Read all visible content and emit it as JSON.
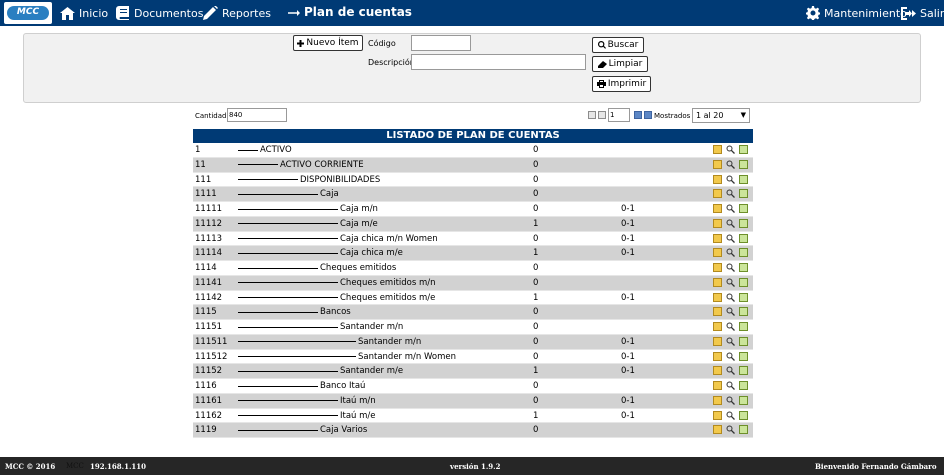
{
  "navbar": {
    "logo_text": "MCC",
    "items": [
      {
        "label": "Inicio",
        "icon": "home-icon"
      },
      {
        "label": "Documentos",
        "icon": "book-icon"
      },
      {
        "label": "Reportes",
        "icon": "pencil-icon"
      }
    ],
    "page_title": "Plan de cuentas",
    "right_items": [
      {
        "label": "Mantenimiento",
        "icon": "gear-icon"
      },
      {
        "label": "Salir",
        "icon": "sign-out-icon"
      }
    ]
  },
  "filter": {
    "new_item_label": "Nuevo Ítem",
    "codigo_label": "Código",
    "codigo_value": "",
    "descripcion_label": "Descripción",
    "descripcion_value": "",
    "buscar_label": "Buscar",
    "limpiar_label": "Limpiar",
    "imprimir_label": "Imprimir"
  },
  "listing": {
    "cantidad_label": "Cantidad",
    "cantidad_value": "840",
    "page_value": "1",
    "mostrados_label": "Mostrados",
    "mostrados_value": "1 al 20"
  },
  "table": {
    "title": "LISTADO DE PLAN DE CUENTAS",
    "rows": [
      {
        "code": "1",
        "level": 1,
        "desc": "ACTIVO",
        "val": "0",
        "ref": ""
      },
      {
        "code": "11",
        "level": 2,
        "desc": "ACTIVO CORRIENTE",
        "val": "0",
        "ref": ""
      },
      {
        "code": "111",
        "level": 3,
        "desc": "DISPONIBILIDADES",
        "val": "0",
        "ref": ""
      },
      {
        "code": "1111",
        "level": 4,
        "desc": "Caja",
        "val": "0",
        "ref": ""
      },
      {
        "code": "11111",
        "level": 5,
        "desc": "Caja m/n",
        "val": "0",
        "ref": "0-1"
      },
      {
        "code": "11112",
        "level": 5,
        "desc": "Caja m/e",
        "val": "1",
        "ref": "0-1"
      },
      {
        "code": "11113",
        "level": 5,
        "desc": "Caja chica m/n Women",
        "val": "0",
        "ref": "0-1"
      },
      {
        "code": "11114",
        "level": 5,
        "desc": "Caja chica m/e",
        "val": "1",
        "ref": "0-1"
      },
      {
        "code": "1114",
        "level": 4,
        "desc": "Cheques emitidos",
        "val": "0",
        "ref": ""
      },
      {
        "code": "11141",
        "level": 5,
        "desc": "Cheques emitidos m/n",
        "val": "0",
        "ref": ""
      },
      {
        "code": "11142",
        "level": 5,
        "desc": "Cheques emitidos m/e",
        "val": "1",
        "ref": "0-1"
      },
      {
        "code": "1115",
        "level": 4,
        "desc": "Bancos",
        "val": "0",
        "ref": ""
      },
      {
        "code": "11151",
        "level": 5,
        "desc": "Santander m/n",
        "val": "0",
        "ref": ""
      },
      {
        "code": "111511",
        "level": 6,
        "desc": "Santander m/n",
        "val": "0",
        "ref": "0-1"
      },
      {
        "code": "111512",
        "level": 6,
        "desc": "Santander m/n Women",
        "val": "0",
        "ref": "0-1"
      },
      {
        "code": "11152",
        "level": 5,
        "desc": "Santander m/e",
        "val": "1",
        "ref": "0-1"
      },
      {
        "code": "1116",
        "level": 4,
        "desc": "Banco Itaú",
        "val": "0",
        "ref": ""
      },
      {
        "code": "11161",
        "level": 5,
        "desc": "Itaú m/n",
        "val": "0",
        "ref": "0-1"
      },
      {
        "code": "11162",
        "level": 5,
        "desc": "Itaú m/e",
        "val": "1",
        "ref": "0-1"
      },
      {
        "code": "1119",
        "level": 4,
        "desc": "Caja Varios",
        "val": "0",
        "ref": ""
      }
    ]
  },
  "footer": {
    "copyright": "MCC © 2016",
    "brand": "MCC",
    "ip": "192.168.1.110",
    "version": "versión 1.9.2",
    "welcome": "Bienvenido Fernando Gámbaro"
  },
  "colors": {
    "navbar_bg": "#003a75",
    "table_header_bg": "#003a75",
    "row_alt_bg": "#d2d2d2",
    "footer_bg": "#262626"
  }
}
